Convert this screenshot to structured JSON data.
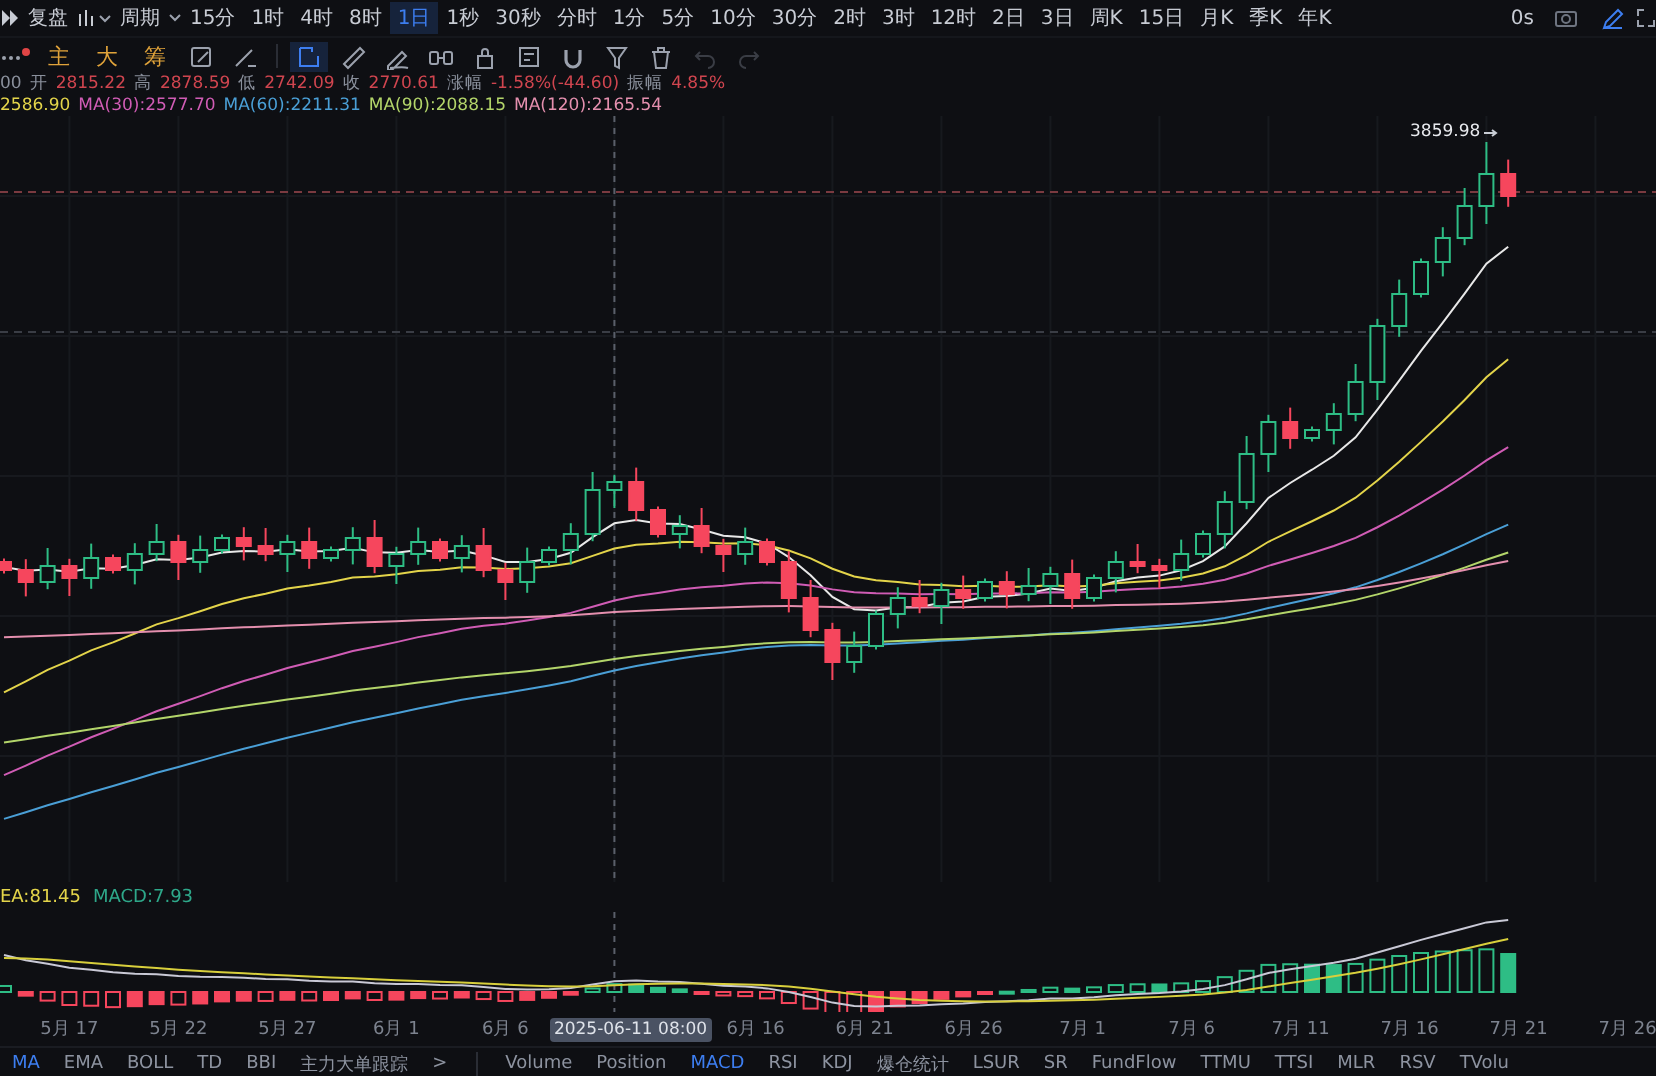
{
  "top_bar": {
    "replay_label": "复盘",
    "period_label": "周期",
    "intervals": [
      {
        "label": "15分",
        "selected": false
      },
      {
        "label": "1时",
        "selected": false
      },
      {
        "label": "4时",
        "selected": false
      },
      {
        "label": "8时",
        "selected": false
      },
      {
        "label": "1日",
        "selected": true
      },
      {
        "label": "1秒",
        "selected": false
      },
      {
        "label": "30秒",
        "selected": false
      },
      {
        "label": "分时",
        "selected": false
      },
      {
        "label": "1分",
        "selected": false
      },
      {
        "label": "5分",
        "selected": false
      },
      {
        "label": "10分",
        "selected": false
      },
      {
        "label": "30分",
        "selected": false
      },
      {
        "label": "2时",
        "selected": false
      },
      {
        "label": "3时",
        "selected": false
      },
      {
        "label": "12时",
        "selected": false
      },
      {
        "label": "2日",
        "selected": false
      },
      {
        "label": "3日",
        "selected": false
      },
      {
        "label": "周K",
        "selected": false
      },
      {
        "label": "15日",
        "selected": false
      },
      {
        "label": "月K",
        "selected": false
      },
      {
        "label": "季K",
        "selected": false
      },
      {
        "label": "年K",
        "selected": false
      }
    ],
    "timer": "0s"
  },
  "tool_bar": {
    "quick_buttons": [
      "主",
      "大",
      "筹"
    ],
    "tools": [
      {
        "selected": false,
        "disabled": false
      },
      {
        "selected": false,
        "disabled": false
      },
      {
        "selected": true,
        "disabled": false
      },
      {
        "selected": false,
        "disabled": false
      },
      {
        "selected": false,
        "disabled": false
      },
      {
        "selected": false,
        "disabled": false
      },
      {
        "selected": false,
        "disabled": false
      },
      {
        "selected": false,
        "disabled": false
      },
      {
        "selected": false,
        "disabled": false
      },
      {
        "selected": false,
        "disabled": false
      },
      {
        "selected": false,
        "disabled": false
      },
      {
        "selected": false,
        "disabled": true
      },
      {
        "selected": false,
        "disabled": true
      }
    ]
  },
  "ohlc": {
    "prefix": "00",
    "fields": [
      {
        "label": "开",
        "value": "2815.22"
      },
      {
        "label": "高",
        "value": "2878.59"
      },
      {
        "label": "低",
        "value": "2742.09"
      },
      {
        "label": "收",
        "value": "2770.61"
      },
      {
        "label": "涨幅",
        "value": "-1.58%(-44.60)"
      },
      {
        "label": "振幅",
        "value": "4.85%"
      }
    ]
  },
  "moving_averages": [
    {
      "text": "2586.90",
      "color": "#e3d44a"
    },
    {
      "text": "MA(30):2577.70",
      "color": "#d05cb5"
    },
    {
      "text": "MA(60):2211.31",
      "color": "#4a9fd6"
    },
    {
      "text": "MA(90):2088.15",
      "color": "#b3d56a"
    },
    {
      "text": "MA(120):2165.54",
      "color": "#e48fae"
    }
  ],
  "main_chart": {
    "high_label": "3859.98"
  },
  "macd_panel": {
    "legend": [
      {
        "text": "EA:81.45",
        "color": "#e3d44a"
      },
      {
        "text": "MACD:7.93",
        "color": "#2ea88a"
      }
    ]
  },
  "x_axis": {
    "labels": [
      {
        "text": "5月 17",
        "kind": "date"
      },
      {
        "text": "5月 22",
        "kind": "date"
      },
      {
        "text": "5月 27",
        "kind": "date"
      },
      {
        "text": "6月 1",
        "kind": "date"
      },
      {
        "text": "6月 6",
        "kind": "date"
      },
      {
        "text": "2025-06-11 08:00",
        "kind": "crosshair"
      },
      {
        "text": "6月 16",
        "kind": "date"
      },
      {
        "text": "6月 21",
        "kind": "date"
      },
      {
        "text": "6月 26",
        "kind": "date"
      },
      {
        "text": "7月 1",
        "kind": "date"
      },
      {
        "text": "7月 6",
        "kind": "date"
      },
      {
        "text": "7月 11",
        "kind": "date"
      },
      {
        "text": "7月 16",
        "kind": "date"
      },
      {
        "text": "7月 21",
        "kind": "date"
      },
      {
        "text": "7月 26",
        "kind": "date"
      }
    ]
  },
  "indicator_tabs": {
    "main": [
      {
        "label": "MA",
        "selected": true
      },
      {
        "label": "EMA",
        "selected": false
      },
      {
        "label": "BOLL",
        "selected": false
      },
      {
        "label": "TD",
        "selected": false
      },
      {
        "label": "BBI",
        "selected": false
      },
      {
        "label": "主力大单跟踪",
        "selected": false
      }
    ],
    "more": ">",
    "sub": [
      {
        "label": "Volume",
        "selected": false
      },
      {
        "label": "Position",
        "selected": false
      },
      {
        "label": "MACD",
        "selected": true
      },
      {
        "label": "RSI",
        "selected": false
      },
      {
        "label": "KDJ",
        "selected": false
      },
      {
        "label": "爆仓统计",
        "selected": false
      },
      {
        "label": "LSUR",
        "selected": false
      },
      {
        "label": "SR",
        "selected": false
      },
      {
        "label": "FundFlow",
        "selected": false
      },
      {
        "label": "TTMU",
        "selected": false
      },
      {
        "label": "TTSI",
        "selected": false
      },
      {
        "label": "MLR",
        "selected": false
      },
      {
        "label": "RSV",
        "selected": false
      },
      {
        "label": "TVolu",
        "selected": false
      }
    ]
  }
}
